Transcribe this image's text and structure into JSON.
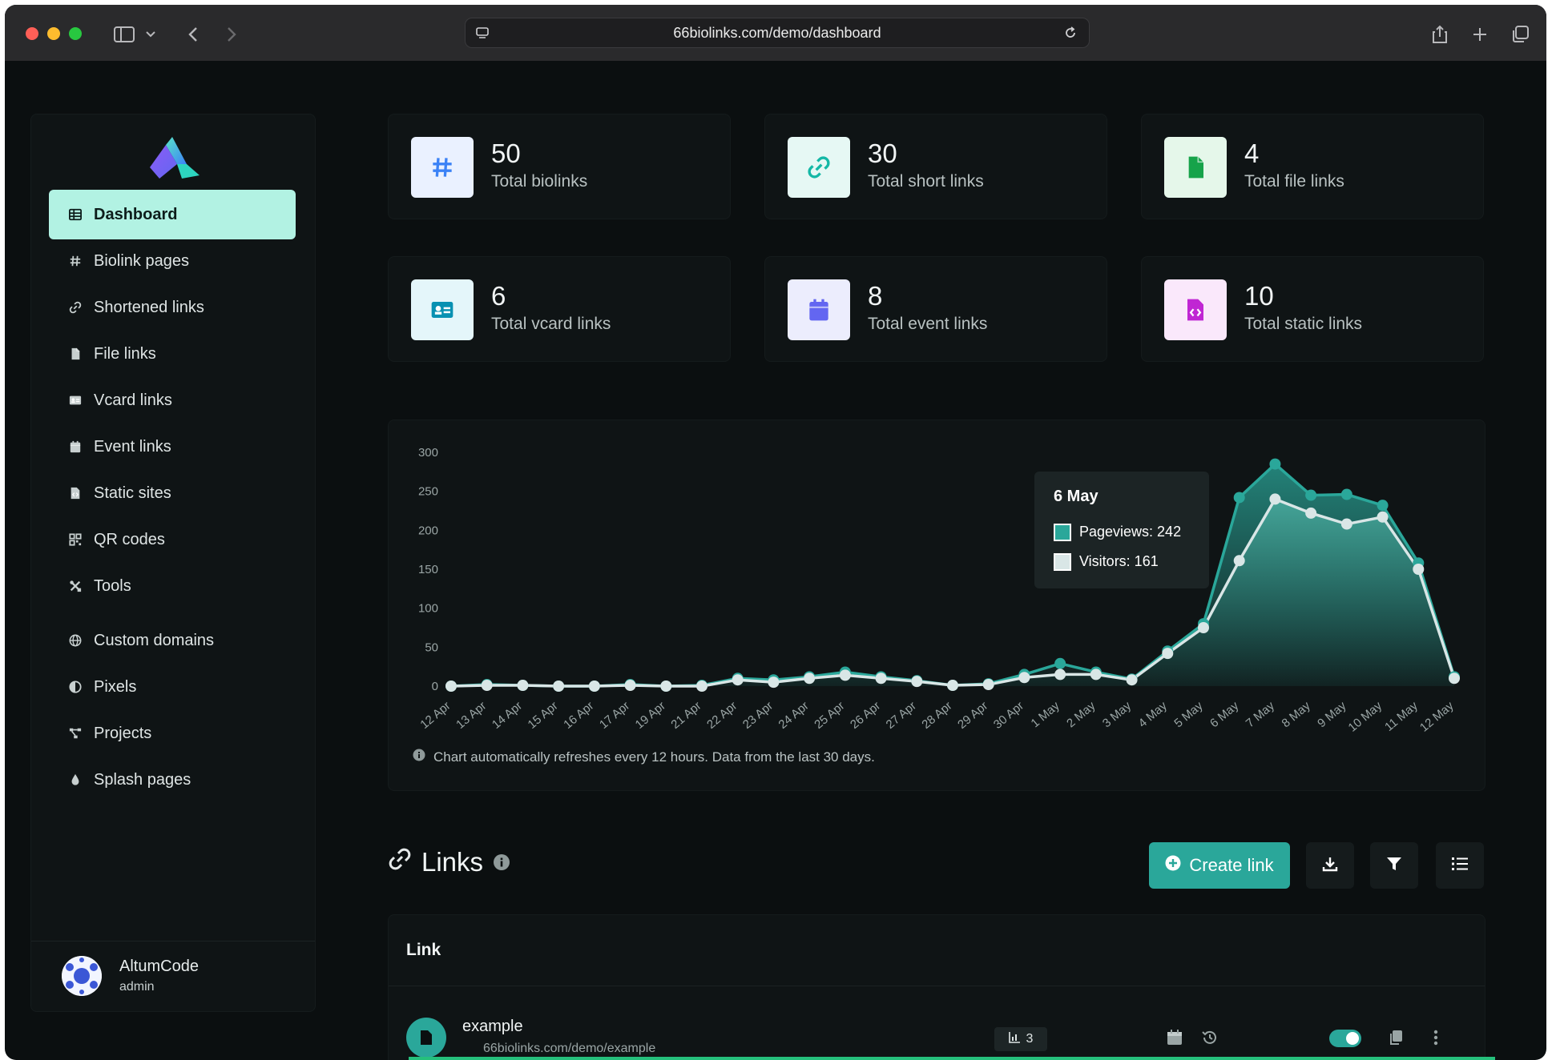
{
  "browser": {
    "url": "66biolinks.com/demo/dashboard"
  },
  "sidebar": {
    "items": [
      {
        "label": "Dashboard",
        "icon": "table-icon",
        "active": true
      },
      {
        "label": "Biolink pages",
        "icon": "hash-icon"
      },
      {
        "label": "Shortened links",
        "icon": "link-icon"
      },
      {
        "label": "File links",
        "icon": "file-icon"
      },
      {
        "label": "Vcard links",
        "icon": "id-card-icon"
      },
      {
        "label": "Event links",
        "icon": "calendar-icon"
      },
      {
        "label": "Static sites",
        "icon": "file-code-icon"
      },
      {
        "label": "QR codes",
        "icon": "qr-code-icon"
      },
      {
        "label": "Tools",
        "icon": "tools-icon"
      },
      {
        "label": "Custom domains",
        "icon": "globe-icon"
      },
      {
        "label": "Pixels",
        "icon": "adjust-icon"
      },
      {
        "label": "Projects",
        "icon": "project-diagram-icon"
      },
      {
        "label": "Splash pages",
        "icon": "droplet-icon"
      }
    ],
    "user": {
      "name": "AltumCode",
      "role": "admin"
    }
  },
  "stats": [
    {
      "value": "50",
      "label": "Total biolinks",
      "icon": "hash-icon",
      "color": "#3b82f6",
      "bg": "#eaf1ff"
    },
    {
      "value": "30",
      "label": "Total short links",
      "icon": "link-icon",
      "color": "#14b8a6",
      "bg": "#e6f8f4"
    },
    {
      "value": "4",
      "label": "Total file links",
      "icon": "file-icon",
      "color": "#16a34a",
      "bg": "#e5f7ea"
    },
    {
      "value": "6",
      "label": "Total vcard links",
      "icon": "id-card-icon",
      "color": "#0891b2",
      "bg": "#e4f6fa"
    },
    {
      "value": "8",
      "label": "Total event links",
      "icon": "calendar-icon",
      "color": "#6366f1",
      "bg": "#ecedfd"
    },
    {
      "value": "10",
      "label": "Total static links",
      "icon": "file-code-icon",
      "color": "#c026d3",
      "bg": "#fae8fb"
    }
  ],
  "chart_data": {
    "type": "area",
    "x": [
      "12 Apr",
      "13 Apr",
      "14 Apr",
      "15 Apr",
      "16 Apr",
      "17 Apr",
      "19 Apr",
      "21 Apr",
      "22 Apr",
      "23 Apr",
      "24 Apr",
      "25 Apr",
      "26 Apr",
      "27 Apr",
      "28 Apr",
      "29 Apr",
      "30 Apr",
      "1 May",
      "2 May",
      "3 May",
      "4 May",
      "5 May",
      "6 May",
      "7 May",
      "8 May",
      "9 May",
      "10 May",
      "11 May",
      "12 May"
    ],
    "series": [
      {
        "name": "Pageviews",
        "color": "#2aa79a",
        "values": [
          0,
          2,
          1,
          0,
          0,
          2,
          0,
          1,
          10,
          8,
          12,
          18,
          12,
          7,
          1,
          3,
          15,
          29,
          18,
          9,
          45,
          80,
          242,
          285,
          245,
          246,
          232,
          158,
          12
        ]
      },
      {
        "name": "Visitors",
        "color": "#d9e6e6",
        "values": [
          0,
          1,
          1,
          0,
          0,
          1,
          0,
          0,
          8,
          5,
          10,
          14,
          10,
          6,
          1,
          2,
          11,
          15,
          15,
          8,
          42,
          75,
          161,
          240,
          222,
          208,
          217,
          150,
          10
        ]
      }
    ],
    "yticks": [
      0,
      50,
      100,
      150,
      200,
      250,
      300
    ],
    "ylim": [
      0,
      300
    ],
    "tooltip": {
      "title": "6 May",
      "rows": [
        {
          "label": "Pageviews: 242"
        },
        {
          "label": "Visitors: 161"
        }
      ]
    },
    "note": "Chart automatically refreshes every 12 hours. Data from the last 30 days."
  },
  "links": {
    "title": "Links",
    "create_label": "Create link",
    "table_header": "Link",
    "rows": [
      {
        "name": "example",
        "url": "66biolinks.com/demo/example",
        "clicks": "3"
      }
    ]
  }
}
